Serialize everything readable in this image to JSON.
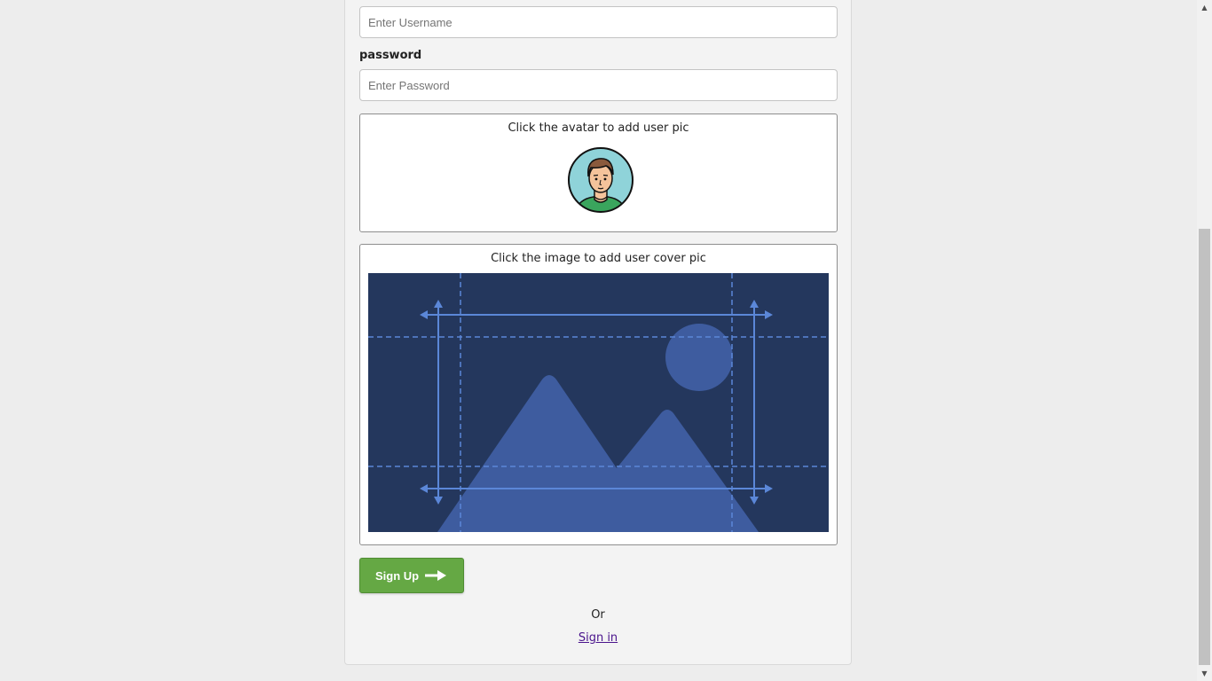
{
  "form": {
    "username": {
      "value": "",
      "placeholder": "Enter Username"
    },
    "password": {
      "label": "password",
      "value": "",
      "placeholder": "Enter Password"
    }
  },
  "avatar_section": {
    "prompt": "Click the avatar to add user pic",
    "icon": "user-avatar-icon"
  },
  "cover_section": {
    "prompt": "Click the image to add user cover pic",
    "icon": "image-placeholder-icon"
  },
  "actions": {
    "signup_label": "Sign Up",
    "signup_icon": "arrow-right-icon",
    "or_text": "Or",
    "signin_link": "Sign in"
  },
  "colors": {
    "primary_button": "#65a844",
    "link": "#4a148c",
    "cover_bg": "#24375d",
    "cover_accent": "#5b87d8"
  }
}
